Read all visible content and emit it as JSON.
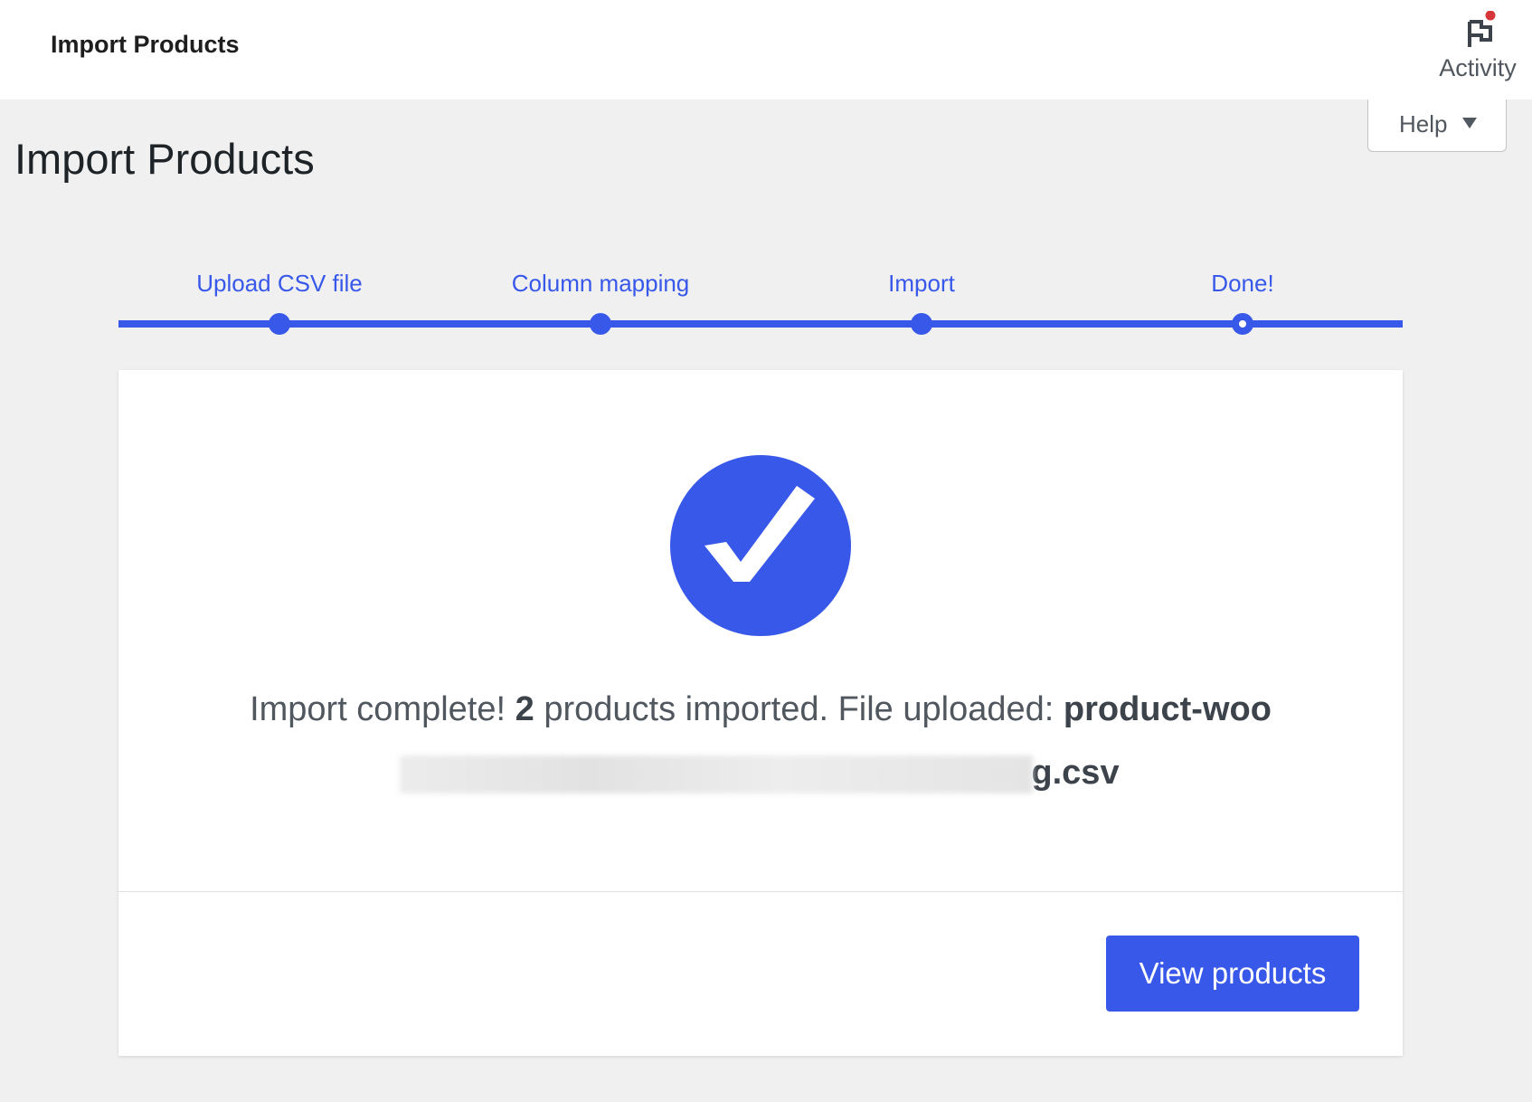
{
  "header": {
    "title": "Import Products",
    "activity_label": "Activity",
    "help_label": "Help"
  },
  "page": {
    "title": "Import Products"
  },
  "steps": [
    {
      "label": "Upload CSV file",
      "state": "done"
    },
    {
      "label": "Column mapping",
      "state": "done"
    },
    {
      "label": "Import",
      "state": "done"
    },
    {
      "label": "Done!",
      "state": "current"
    }
  ],
  "result": {
    "prefix": "Import complete! ",
    "count": "2",
    "middle": " products imported. File uploaded: ",
    "file_start": "product-woo",
    "file_end": "g.csv"
  },
  "actions": {
    "view_products": "View products"
  },
  "colors": {
    "accent": "#3858e9",
    "notification": "#d63638"
  }
}
